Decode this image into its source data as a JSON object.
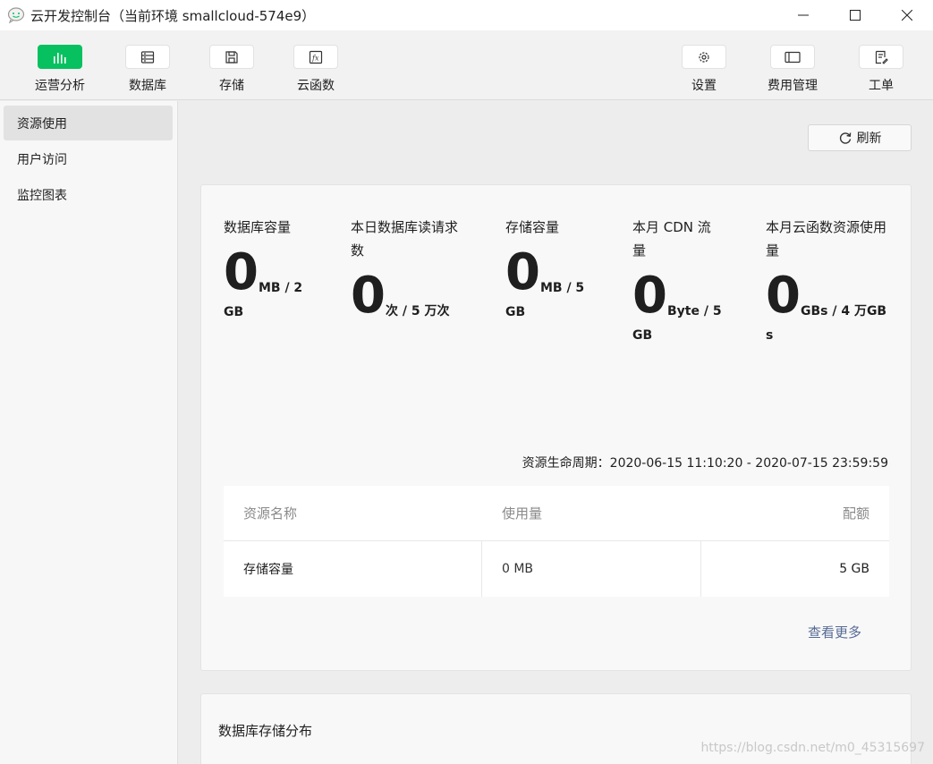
{
  "window": {
    "title": "云开发控制台（当前环境 smallcloud-574e9）"
  },
  "toolbar": {
    "left": [
      {
        "label": "运营分析",
        "icon": "bar-chart-icon",
        "active": true
      },
      {
        "label": "数据库",
        "icon": "database-icon",
        "active": false
      },
      {
        "label": "存储",
        "icon": "storage-icon",
        "active": false
      },
      {
        "label": "云函数",
        "icon": "function-icon",
        "active": false
      }
    ],
    "right": [
      {
        "label": "设置",
        "icon": "gear-icon"
      },
      {
        "label": "费用管理",
        "icon": "billing-icon"
      },
      {
        "label": "工单",
        "icon": "ticket-icon"
      }
    ]
  },
  "sidebar": {
    "items": [
      {
        "label": "资源使用",
        "active": true
      },
      {
        "label": "用户访问",
        "active": false
      },
      {
        "label": "监控图表",
        "active": false
      }
    ]
  },
  "main": {
    "refresh_label": "刷新",
    "metrics": [
      {
        "label": "数据库容量",
        "value": "0",
        "unit": "MB / 2 GB"
      },
      {
        "label": "本日数据库读请求数",
        "value": "0",
        "unit": "次 / 5 万次"
      },
      {
        "label": "存储容量",
        "value": "0",
        "unit": "MB / 5 GB"
      },
      {
        "label": "本月 CDN 流量",
        "value": "0",
        "unit": "Byte / 5 GB"
      },
      {
        "label": "本月云函数资源使用量",
        "value": "0",
        "unit": "GBs / 4 万GBs"
      }
    ],
    "lifecycle_label": "资源生命周期：",
    "lifecycle_value": "2020-06-15 11:10:20 - 2020-07-15 23:59:59",
    "table": {
      "headers": [
        "资源名称",
        "使用量",
        "配额"
      ],
      "rows": [
        {
          "name": "存储容量",
          "usage": "0 MB",
          "quota": "5 GB"
        }
      ]
    },
    "more_label": "查看更多",
    "section2_title": "数据库存储分布"
  },
  "watermark": "https://blog.csdn.net/m0_45315697",
  "colors": {
    "accent": "#07c160",
    "link": "#576b95"
  }
}
